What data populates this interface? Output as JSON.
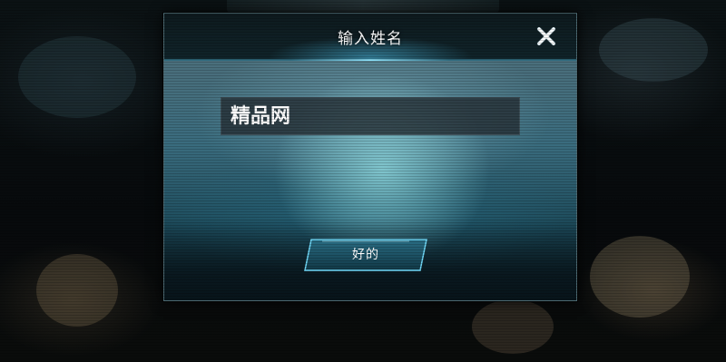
{
  "dialog": {
    "title": "输入姓名",
    "name_value": "精品网",
    "confirm_label": "好的",
    "close_icon": "close-icon"
  },
  "colors": {
    "accent": "#5fd0f2",
    "title_text": "#ffffff",
    "field_bg": "#263036",
    "button_fill": "#1a5063"
  }
}
